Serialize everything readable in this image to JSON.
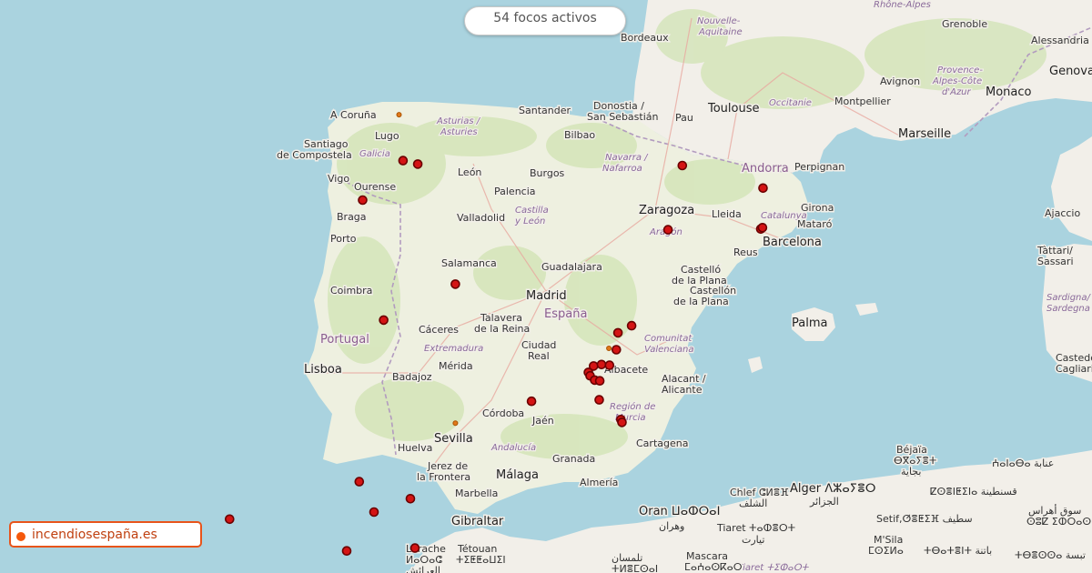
{
  "counter_label": "54 focos activos",
  "brand_label": "incendiosespaña.es",
  "colors": {
    "fire": "#d41414",
    "small_fire": "#e0781a",
    "brand": "#e8541a",
    "sea": "#aad3df",
    "land": "#f2efe9"
  },
  "places": {
    "bordeaux": "Bordeaux",
    "nouvelle": "Nouvelle-",
    "aquitaine": "Aquitaine",
    "toulouse": "Toulouse",
    "occitanie": "Occitanie",
    "montpellier": "Montpellier",
    "avignon": "Avignon",
    "marseille": "Marseille",
    "monaco": "Monaco",
    "genova": "Genova",
    "alessandria": "Alessandria",
    "rhone": "Rhône-Alpes",
    "provence1": "Provence-",
    "provence2": "Alpes-Côte",
    "provence3": "d'Azur",
    "grenoble": "Grenoble",
    "pau": "Pau",
    "perpignan": "Perpignan",
    "andorra": "Andorra",
    "girona": "Girona",
    "matar": "Mataró",
    "barcelona": "Barcelona",
    "reus": "Reus",
    "lleida": "Lleida",
    "catalunya": "Catalunya",
    "zaragoza": "Zaragoza",
    "aragon": "Aragón",
    "navarra1": "Navarra /",
    "navarra2": "Nafarroa",
    "donostia1": "Donostia /",
    "donostia2": "San Sebastián",
    "santander": "Santander",
    "bilbao": "Bilbao",
    "burgos": "Burgos",
    "coruna": "A Coruña",
    "lugo": "Lugo",
    "asturias1": "Asturias /",
    "asturias2": "Asturies",
    "santiago1": "Santiago",
    "santiago2": "de Compostela",
    "galicia": "Galicia",
    "leon": "León",
    "ourense": "Ourense",
    "vigo": "Vigo",
    "braga": "Braga",
    "palencia": "Palencia",
    "valladolid": "Valladolid",
    "castilla1": "Castilla",
    "castilla2": "y León",
    "porto": "Porto",
    "salamanca": "Salamanca",
    "guadalajara": "Guadalajara",
    "madrid": "Madrid",
    "espana": "España",
    "coimbra": "Coimbra",
    "talavera1": "Talavera",
    "talavera2": "de la Reina",
    "caceres": "Cáceres",
    "portugal": "Portugal",
    "extremadura": "Extremadura",
    "ciudadreal1": "Ciudad",
    "ciudadreal2": "Real",
    "lisboa": "Lisboa",
    "badajoz": "Badajoz",
    "merida": "Mérida",
    "albacete": "Albacete",
    "castello1": "Castelló",
    "castello2": "de la Plana",
    "castellon1": "Castellón",
    "castellon2": "de la Plana",
    "comunitat1": "Comunitat",
    "comunitat2": "Valenciana",
    "alacant1": "Alacant /",
    "alacant2": "Alicante",
    "murcia1": "Región de",
    "murcia2": "Murcia",
    "cartagena": "Cartagena",
    "cordoba": "Córdoba",
    "jaen": "Jaén",
    "sevilla": "Sevilla",
    "andalucia": "Andalucía",
    "huelva": "Huelva",
    "granada": "Granada",
    "almeria": "Almería",
    "jerez1": "Jerez de",
    "jerez2": "la Frontera",
    "malaga": "Málaga",
    "marbella": "Marbella",
    "gibraltar": "Gibraltar",
    "palma": "Palma",
    "ajaccio": "Ajaccio",
    "tattari1": "Tàttari/",
    "tattari2": "Sassari",
    "sardegna1": "Sardigna/",
    "sardegna2": "Sardegna",
    "casteddu1": "Casteddu",
    "casteddu2": "Cagliari",
    "bejaia1": "Béjaïa",
    "bejaia2": "ⴱⴳⴰⵢⴻⵜ",
    "bejaia3": "بجاية",
    "annaba": "ⵄⴰⵏⴰⴱⴰ عنابة",
    "constantine1": "ⵇⵙⴻⵏⵟⵉⵏⴰ قسنطينة",
    "souk1": "سوق أهراس",
    "souk2": "ⵙⵓⵇ ⵉⵀⵔⴰⵙ",
    "alger1": "Alger ⴷⵣⴰⵢⴻⵔ",
    "alger2": "الجزائر",
    "chlef1": "Chlef ⵛⵍⴻⴼ",
    "chlef2": "الشلف",
    "setif": "Setif,ⵚⴻⵟⵉⴼ سطيف",
    "msila1": "M'Sila",
    "msila2": "ⵎⵙⵉⵍⴰ",
    "batna": "ⵜⴱⴰⵜⴻⵏⵜ باتنة",
    "tebessa": "ⵜⴱⴻⵙⵙⴰ تبسة",
    "tiaret1": "Tiaret ⵜⴰⵀⴻⵔⵜ",
    "tiaret2": "تيارت",
    "oran1": "Oran ⵡⴰⵀⵔⴰⵏ",
    "oran2": "وهران",
    "mascara1": "Mascara",
    "mascara2": "ⵎⴰⵄⴰⵙⴽⴰⵔ",
    "tiaretreg": "Tiaret ⵜⵉⵀⴰⵔⵜ",
    "tlemcen1": "تلمسان",
    "tlemcen2": "ⵜⵍⴻⵎⵙⴰⵏ",
    "larache1": "Larache",
    "larache2": "ⵍⴰⵔⴰⵛ",
    "larache3": "العرائش",
    "tetouan1": "Tétouan",
    "tetouan2": "ⵜⵉⵟⵟⴰⵡⵉⵏ"
  },
  "fires": [
    {
      "lon": -3.81,
      "lat": 42.53,
      "size": "big"
    },
    {
      "lon": -3.55,
      "lat": 42.48,
      "size": "big"
    },
    {
      "lon": -4.52,
      "lat": 41.97,
      "size": "big"
    },
    {
      "lon": 1.1,
      "lat": 42.46,
      "size": "big"
    },
    {
      "lon": 2.52,
      "lat": 42.14,
      "size": "big"
    },
    {
      "lon": 2.48,
      "lat": 41.56,
      "size": "big"
    },
    {
      "lon": 2.51,
      "lat": 41.58,
      "size": "big"
    },
    {
      "lon": 0.85,
      "lat": 41.55,
      "size": "big"
    },
    {
      "lon": -2.89,
      "lat": 40.78,
      "size": "big"
    },
    {
      "lon": -4.15,
      "lat": 40.27,
      "size": "big"
    },
    {
      "lon": 0.21,
      "lat": 40.19,
      "size": "big"
    },
    {
      "lon": -0.03,
      "lat": 40.09,
      "size": "big"
    },
    {
      "lon": -0.06,
      "lat": 39.85,
      "size": "big"
    },
    {
      "lon": -0.46,
      "lat": 39.62,
      "size": "big"
    },
    {
      "lon": -0.32,
      "lat": 39.64,
      "size": "big"
    },
    {
      "lon": -0.18,
      "lat": 39.63,
      "size": "big"
    },
    {
      "lon": -0.55,
      "lat": 39.53,
      "size": "big"
    },
    {
      "lon": -0.52,
      "lat": 39.48,
      "size": "big"
    },
    {
      "lon": -0.44,
      "lat": 39.42,
      "size": "big"
    },
    {
      "lon": -0.35,
      "lat": 39.41,
      "size": "big"
    },
    {
      "lon": -0.36,
      "lat": 39.14,
      "size": "big"
    },
    {
      "lon": -1.55,
      "lat": 39.12,
      "size": "big"
    },
    {
      "lon": 0.02,
      "lat": 38.86,
      "size": "big"
    },
    {
      "lon": 0.04,
      "lat": 38.82,
      "size": "big"
    },
    {
      "lon": -4.58,
      "lat": 37.98,
      "size": "big"
    },
    {
      "lon": -3.68,
      "lat": 37.74,
      "size": "big"
    },
    {
      "lon": -4.32,
      "lat": 37.55,
      "size": "big"
    },
    {
      "lon": -6.86,
      "lat": 37.45,
      "size": "big"
    },
    {
      "lon": -8.8,
      "lat": 37.26,
      "size": "big"
    },
    {
      "lon": -4.8,
      "lat": 37.0,
      "size": "big"
    },
    {
      "lon": -3.6,
      "lat": 37.04,
      "size": "big"
    },
    {
      "lon": -3.88,
      "lat": 43.18,
      "size": "small"
    },
    {
      "lon": -2.89,
      "lat": 38.81,
      "size": "small"
    },
    {
      "lon": -0.19,
      "lat": 39.87,
      "size": "small"
    }
  ]
}
